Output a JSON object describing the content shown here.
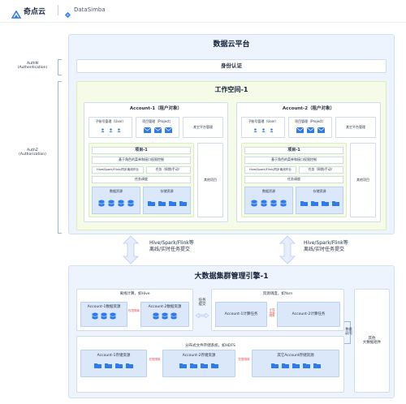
{
  "header": {
    "brand_cn": "奇点云",
    "brand_en": "DataSimba"
  },
  "labels": {
    "authn": "AuthN",
    "authn_en": "(Authentication)",
    "authz": "AuthZ",
    "authz_en": "(Authorization)"
  },
  "platform": {
    "title": "数据云平台",
    "identity": "身份认证",
    "workspace": "工作空间-1",
    "accounts": [
      {
        "title": "Account-1（租户对象）",
        "user_mgmt": "子账号管理（User）",
        "project_mgmt": "项目管理（Project）",
        "other_mgmt": "其它平台管理",
        "project": "项目-1",
        "role_perm": "基于角色的菜单和接口权限控制",
        "jobs": "Hive/Spark/Flink/同步离线作业",
        "tasks": "任务（周期/手动）",
        "schedule": "任务调度",
        "data_res": "数据资源",
        "storage_res": "存储资源",
        "other_proj": "其他项目"
      },
      {
        "title": "Account-2（租户对象）",
        "user_mgmt": "子账号管理（User）",
        "project_mgmt": "项目管理（Project）",
        "other_mgmt": "其它平台管理",
        "project": "项目-1",
        "role_perm": "基于角色的菜单和接口权限控制",
        "jobs": "Hive/Spark/Flink/同步离线作业",
        "tasks": "任务（周期/手动）",
        "schedule": "任务调度",
        "data_res": "数据资源",
        "storage_res": "存储资源",
        "other_proj": "其他项目"
      }
    ]
  },
  "submit": {
    "left_line1": "Hive/Spark/Flink等",
    "left_line2": "离线/实时任务提交",
    "right_line1": "Hive/Spark/Flink等",
    "right_line2": "离线/实时任务提交"
  },
  "engine": {
    "title": "大数据集群管理引擎-1",
    "offline": "离线计算，如Hive",
    "acc1_data": "Account-1数据资源",
    "acc2_data": "Account-2数据资源",
    "isolation": "权限隔离",
    "task_submit_1": "任务",
    "task_submit_2": "提交",
    "resource": "资源调度，如Yarn",
    "acc1_compute": "Account-1计算任务",
    "acc2_compute": "Account-2计算任务",
    "compute_isolation": "计算资源隔离",
    "storage_label": "分布式文件存储系统，如HDFS",
    "acc1_store": "Account-1存储资源",
    "acc2_store": "Account-2存储资源",
    "other_store": "其它Account存储资源",
    "data_rw_1": "数据",
    "data_rw_2": "读/写",
    "other_components_1": "其他",
    "other_components_2": "大数据组件"
  },
  "colors": {
    "accent": "#2f7bea",
    "green_panel": "#f5fbe6",
    "blue_panel": "#eef4fd",
    "red_text": "#e45b5b"
  }
}
